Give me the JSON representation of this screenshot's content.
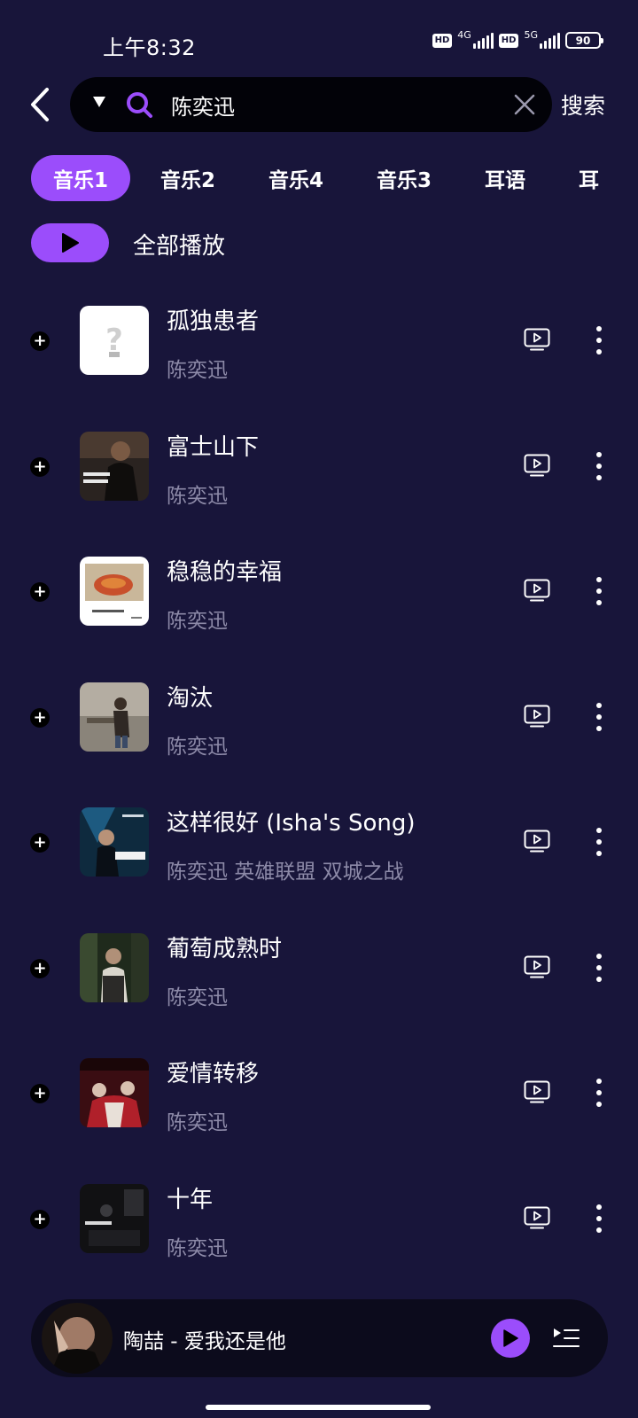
{
  "status": {
    "time": "上午8:32",
    "hd1": "HD",
    "net1": "4G",
    "hd2": "HD",
    "net2": "5G",
    "battery": "90"
  },
  "search": {
    "query": "陈奕迅",
    "button_label": "搜索"
  },
  "tabs": [
    {
      "label": "音乐1",
      "active": true
    },
    {
      "label": "音乐2"
    },
    {
      "label": "音乐4"
    },
    {
      "label": "音乐3"
    },
    {
      "label": "耳语"
    },
    {
      "label": "耳"
    }
  ],
  "play_all": {
    "label": "全部播放"
  },
  "songs": [
    {
      "title": "孤独患者",
      "artist": "陈奕迅"
    },
    {
      "title": "富士山下",
      "artist": "陈奕迅"
    },
    {
      "title": "稳稳的幸福",
      "artist": "陈奕迅"
    },
    {
      "title": "淘汰",
      "artist": "陈奕迅"
    },
    {
      "title": "这样很好 (Isha's Song)",
      "artist": "陈奕迅 英雄联盟 双城之战"
    },
    {
      "title": "葡萄成熟时",
      "artist": "陈奕迅"
    },
    {
      "title": "爱情转移",
      "artist": "陈奕迅"
    },
    {
      "title": "十年",
      "artist": "陈奕迅"
    }
  ],
  "mini_player": {
    "now_playing": "陶喆 - 爱我还是他"
  },
  "colors": {
    "background": "#18153a",
    "accent": "#9b4dfb",
    "secondary_text": "#8d8aa8"
  }
}
